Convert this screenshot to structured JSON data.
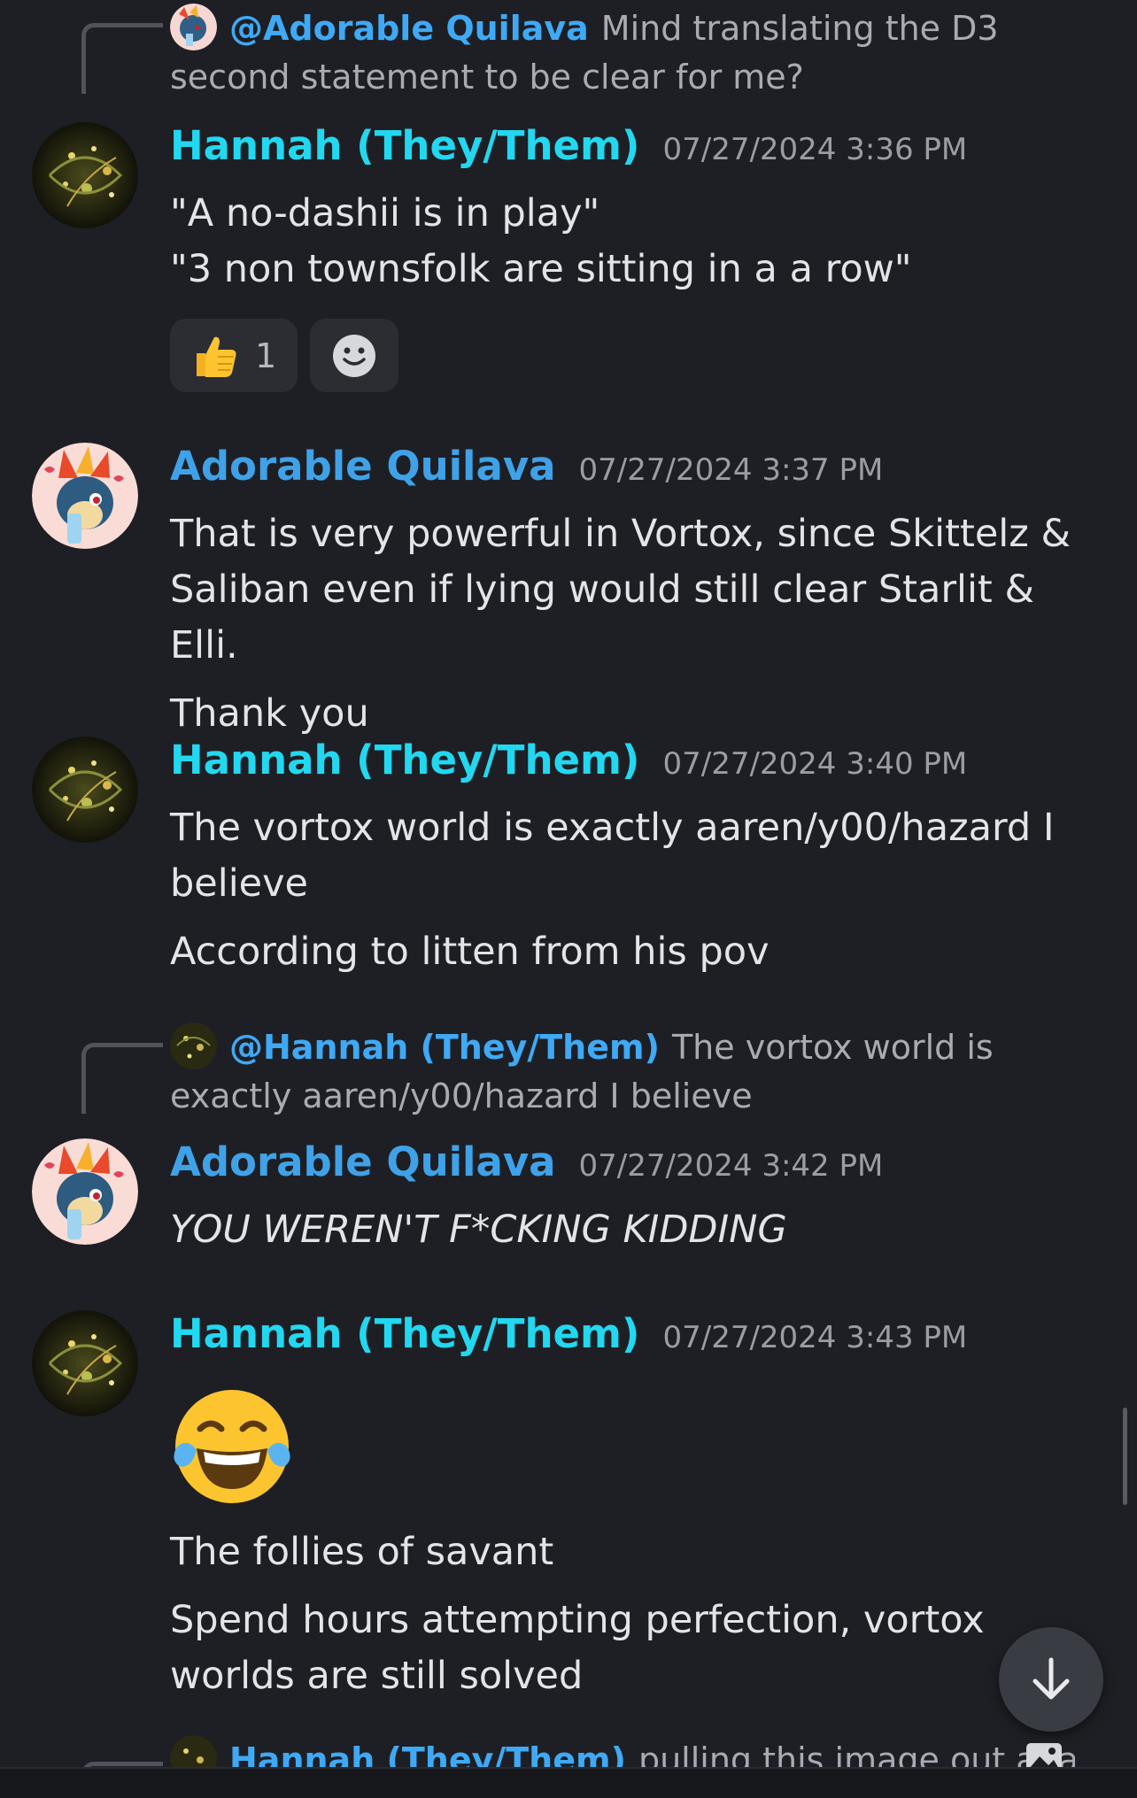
{
  "messages": [
    {
      "reply": {
        "mention": "@Adorable Quilava",
        "text": "Mind translating the D3 second statement to be clear for me?"
      },
      "author": "Hannah (They/Them)",
      "timestamp": "07/27/2024 3:36 PM",
      "lines": [
        "\"A no-dashii is in play\"",
        "\"3 non townsfolk are sitting in a a row\""
      ],
      "reactions": [
        {
          "emoji": "thumbs-up-emoji",
          "count": "1"
        }
      ]
    },
    {
      "author": "Adorable Quilava",
      "timestamp": "07/27/2024 3:37 PM",
      "lines": [
        "That is very powerful in Vortox, since Skittelz & Saliban even if lying would still clear Starlit & Elli.",
        "Thank you"
      ]
    },
    {
      "author": "Hannah (They/Them)",
      "timestamp": "07/27/2024 3:40 PM",
      "lines": [
        "The vortox world is exactly aaren/y00/hazard I believe",
        "According to litten from his pov"
      ]
    },
    {
      "reply": {
        "mention": "@Hannah (They/Them)",
        "text": "The vortox world is exactly aaren/y00/hazard I believe"
      },
      "author": "Adorable Quilava",
      "timestamp": "07/27/2024 3:42 PM",
      "lines": [
        "YOU WEREN'T F*CKING KIDDING"
      ]
    },
    {
      "author": "Hannah (They/Them)",
      "timestamp": "07/27/2024 3:43 PM",
      "emoji": "tears-of-joy-emoji",
      "lines": [
        "The follies of savant",
        "Spend hours attempting perfection, vortox worlds are still solved"
      ]
    },
    {
      "reply": {
        "mention": "Hannah (They/Them)",
        "text": "pulling this image out again"
      }
    }
  ],
  "icons": {
    "add_reaction": "smiley-add-icon",
    "scroll_down": "arrow-down-icon",
    "attachment": "image-icon"
  }
}
